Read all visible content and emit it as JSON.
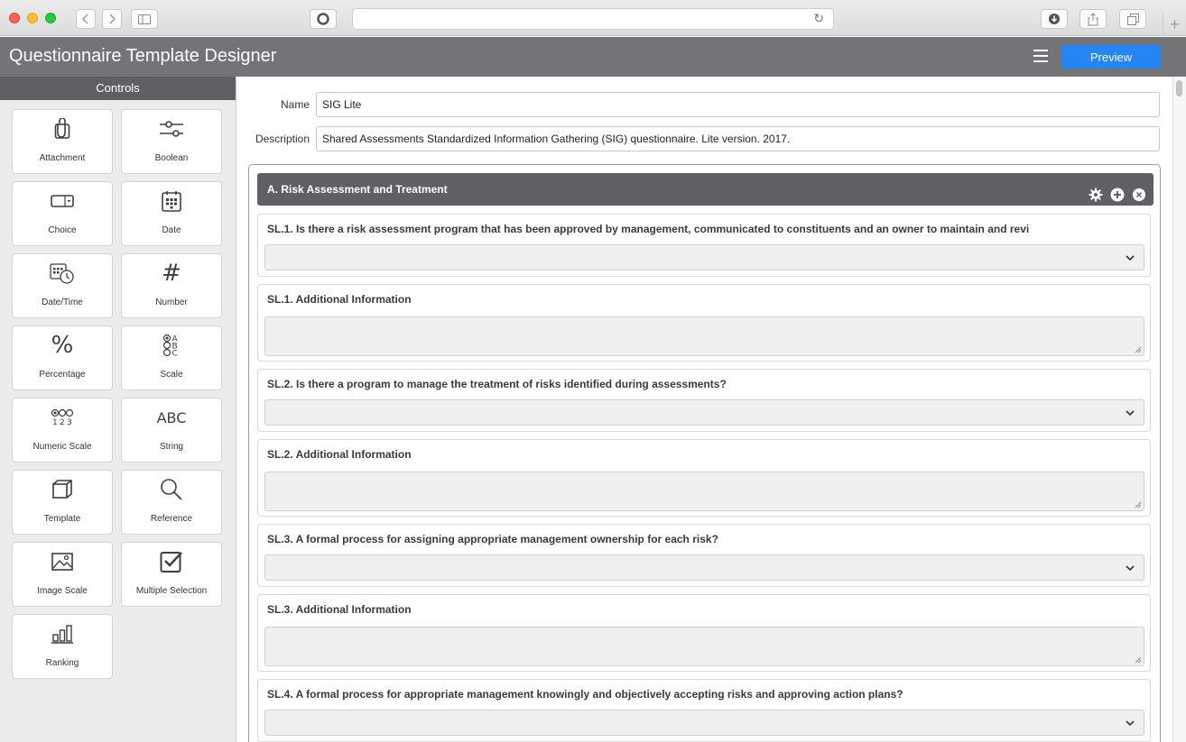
{
  "browser": {
    "traffic_lights": [
      "close",
      "minimize",
      "zoom"
    ],
    "reload_glyph": "↻",
    "new_tab_glyph": "+"
  },
  "app": {
    "title": "Questionnaire Template Designer",
    "preview_label": "Preview",
    "accent_color": "#2486f5",
    "header_color": "#737478"
  },
  "sidebar": {
    "title": "Controls",
    "controls": [
      {
        "label": "Attachment",
        "icon": "paperclip-icon"
      },
      {
        "label": "Boolean",
        "icon": "toggle-icon"
      },
      {
        "label": "Choice",
        "icon": "dropdown-icon"
      },
      {
        "label": "Date",
        "icon": "calendar-icon"
      },
      {
        "label": "Date/Time",
        "icon": "calendar-clock-icon"
      },
      {
        "label": "Number",
        "icon": "hash-icon",
        "glyph": "#"
      },
      {
        "label": "Percentage",
        "icon": "percent-icon",
        "glyph": "%"
      },
      {
        "label": "Scale",
        "icon": "abc-scale-icon"
      },
      {
        "label": "Numeric Scale",
        "icon": "numeric-scale-icon"
      },
      {
        "label": "String",
        "icon": "abc-text-icon",
        "glyph": "ABC"
      },
      {
        "label": "Template",
        "icon": "cube-icon"
      },
      {
        "label": "Reference",
        "icon": "magnifier-icon"
      },
      {
        "label": "Image Scale",
        "icon": "image-icon"
      },
      {
        "label": "Multiple Selection",
        "icon": "checkbox-icon"
      },
      {
        "label": "Ranking",
        "icon": "bar-chart-icon"
      }
    ]
  },
  "form": {
    "name_label": "Name",
    "name_value": "SIG Lite",
    "description_label": "Description",
    "description_value": "Shared Assessments Standardized Information Gathering (SIG) questionnaire. Lite version. 2017."
  },
  "section": {
    "title": "A. Risk Assessment and Treatment",
    "action_icons": [
      "gear-icon",
      "add-circle-icon",
      "close-circle-icon"
    ],
    "questions": [
      {
        "label": "SL.1. Is there a risk assessment program that has been approved by management, communicated to constituents and an owner to maintain and revi",
        "type": "select"
      },
      {
        "label": "SL.1. Additional Information",
        "type": "textarea"
      },
      {
        "label": "SL.2. Is there a program to manage the treatment of risks identified during assessments?",
        "type": "select"
      },
      {
        "label": "SL.2. Additional Information",
        "type": "textarea"
      },
      {
        "label": "SL.3. A formal process for assigning appropriate management ownership for each risk?",
        "type": "select"
      },
      {
        "label": "SL.3. Additional Information",
        "type": "textarea"
      },
      {
        "label": "SL.4. A formal process for appropriate management knowingly and objectively accepting risks and approving action plans?",
        "type": "select"
      }
    ]
  }
}
